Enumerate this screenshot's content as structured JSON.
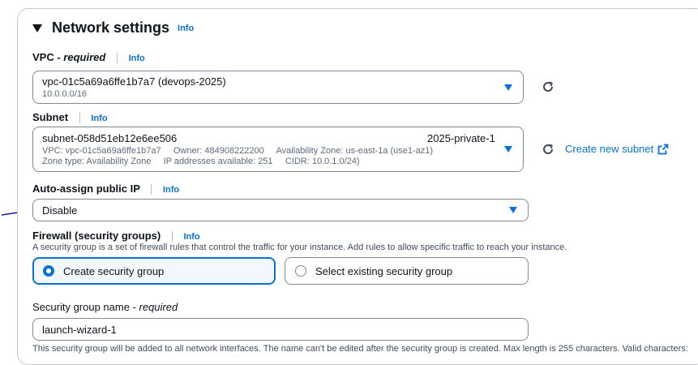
{
  "section": {
    "title": "Network settings",
    "info": "Info"
  },
  "vpc": {
    "label": "VPC - ",
    "required": "required",
    "info": "Info",
    "selected": "vpc-01c5a69a6ffe1b7a7 (devops-2025)",
    "cidr": "10.0.0.0/16"
  },
  "subnet": {
    "label": "Subnet",
    "info": "Info",
    "selected": "subnet-058d51eb12e6ee506",
    "name": "2025-private-1",
    "line1": "VPC: vpc-01c5a69a6ffe1b7a7     Owner: 484908222200     Availability Zone: us-east-1a (use1-az1)",
    "line2": "Zone type: Availability Zone     IP addresses available: 251     CIDR: 10.0.1.0/24)",
    "create_link": "Create new subnet"
  },
  "public_ip": {
    "label": "Auto-assign public IP",
    "info": "Info",
    "selected": "Disable"
  },
  "firewall": {
    "label": "Firewall (security groups)",
    "info": "Info",
    "description": "A security group is a set of firewall rules that control the traffic for your instance. Add rules to allow specific traffic to reach your instance.",
    "options": [
      {
        "label": "Create security group",
        "selected": true
      },
      {
        "label": "Select existing security group",
        "selected": false
      }
    ]
  },
  "sg_name": {
    "label": "Security group name - ",
    "required": "required",
    "value": "launch-wizard-1",
    "note": "This security group will be added to all network interfaces. The name can't be edited after the security group is created. Max length is 255 characters. Valid characters:"
  },
  "colors": {
    "accent": "#0972d3",
    "selected_bg": "#f2f8fd",
    "annotation": "#1a1aa6"
  },
  "icons": {
    "collapse": "caret-down-icon",
    "refresh": "refresh-icon",
    "external": "external-link-icon",
    "dropdown": "dropdown-caret-icon"
  }
}
